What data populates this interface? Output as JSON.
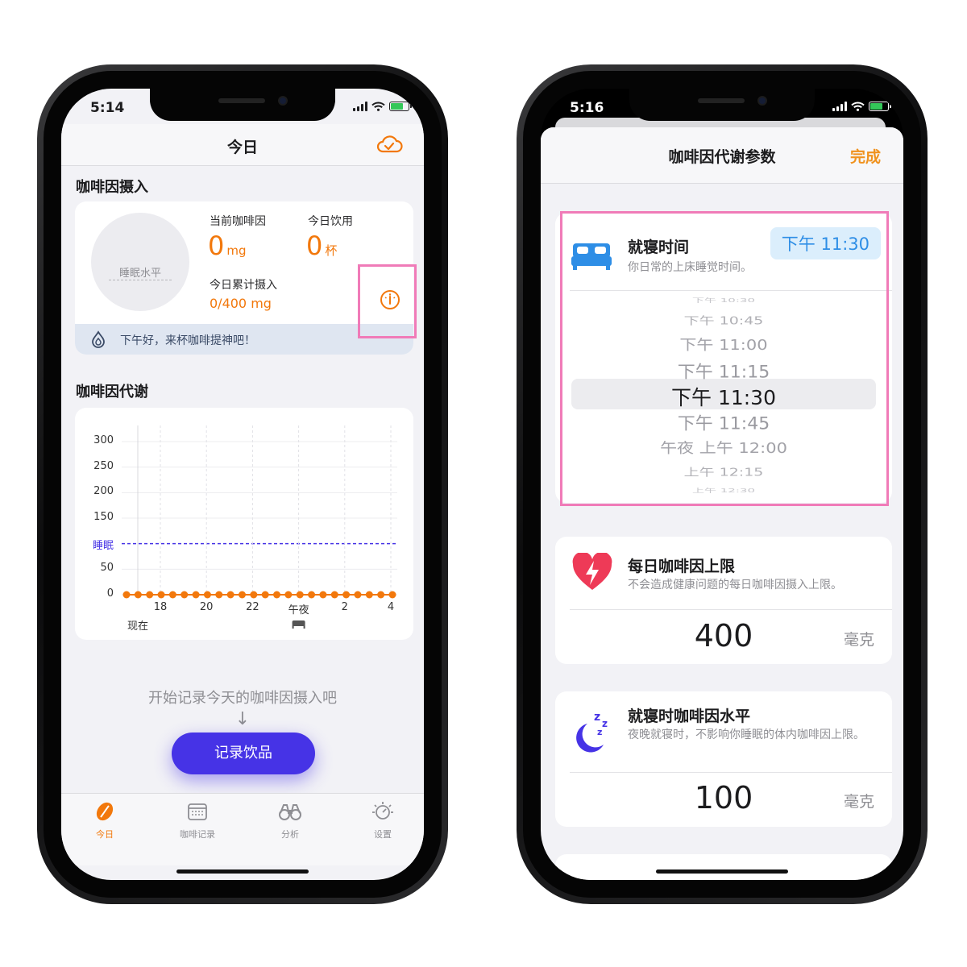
{
  "left": {
    "status_time": "5:14",
    "nav_title": "今日",
    "intake": {
      "section_title": "咖啡因摄入",
      "sleep_level_label": "睡眠水平",
      "current_caffeine_label": "当前咖啡因",
      "current_caffeine_value": "0",
      "current_caffeine_unit": "mg",
      "today_drinks_label": "今日饮用",
      "today_drinks_value": "0",
      "today_drinks_unit": "杯",
      "total_label": "今日累计摄入",
      "total_value": "0/400 mg",
      "greeting": "下午好，来杯咖啡提神吧！"
    },
    "metabolism_title": "咖啡因代谢",
    "chart_data": {
      "type": "line",
      "y_ticks": [
        "300",
        "250",
        "200",
        "150",
        "50",
        "0"
      ],
      "y_ticks_values": [
        300,
        250,
        200,
        150,
        50,
        0
      ],
      "sleep_line_label": "睡眠",
      "sleep_line_value": 100,
      "x_ticks": [
        "18",
        "20",
        "22",
        "午夜",
        "2",
        "4"
      ],
      "now_label": "现在",
      "ylim": [
        0,
        300
      ],
      "series": [
        {
          "values": [
            0,
            0,
            0,
            0,
            0,
            0,
            0,
            0,
            0,
            0,
            0,
            0,
            0,
            0,
            0,
            0,
            0,
            0,
            0,
            0,
            0,
            0,
            0,
            0
          ]
        }
      ],
      "colors": {
        "series": "#f2780c",
        "sleep": "#4633e6"
      }
    },
    "empty_hint": "开始记录今天的咖啡因摄入吧",
    "down_arrow": "↓",
    "record_button": "记录饮品",
    "tabs": [
      {
        "label": "今日",
        "icon": "coffee-bean-icon",
        "active": true
      },
      {
        "label": "咖啡记录",
        "icon": "calendar-icon",
        "active": false
      },
      {
        "label": "分析",
        "icon": "binoculars-icon",
        "active": false
      },
      {
        "label": "设置",
        "icon": "gear-icon",
        "active": false
      }
    ]
  },
  "right": {
    "status_time": "5:16",
    "sheet_title": "咖啡因代谢参数",
    "done_button": "完成",
    "bedtime": {
      "title": "就寝时间",
      "subtitle": "你日常的上床睡觉时间。",
      "value": "下午 11:30",
      "picker_options": [
        "下午 10:30",
        "下午 10:45",
        "下午 11:00",
        "下午 11:15",
        "下午 11:30",
        "下午 11:45",
        "午夜 上午 12:00",
        "上午 12:15",
        "上午 12:30"
      ],
      "selected_index": 4
    },
    "daily_limit": {
      "title": "每日咖啡因上限",
      "subtitle": "不会造成健康问题的每日咖啡因摄入上限。",
      "value": "400",
      "unit": "毫克"
    },
    "bedtime_level": {
      "title": "就寝时咖啡因水平",
      "subtitle": "夜晚就寝时，不影响你睡眠的体内咖啡因上限。",
      "value": "100",
      "unit": "毫克"
    }
  },
  "colors": {
    "accent": "#f2780c",
    "primary": "#4633e6",
    "highlight": "#f07bb8",
    "picker_blue": "#2e8ee6"
  }
}
